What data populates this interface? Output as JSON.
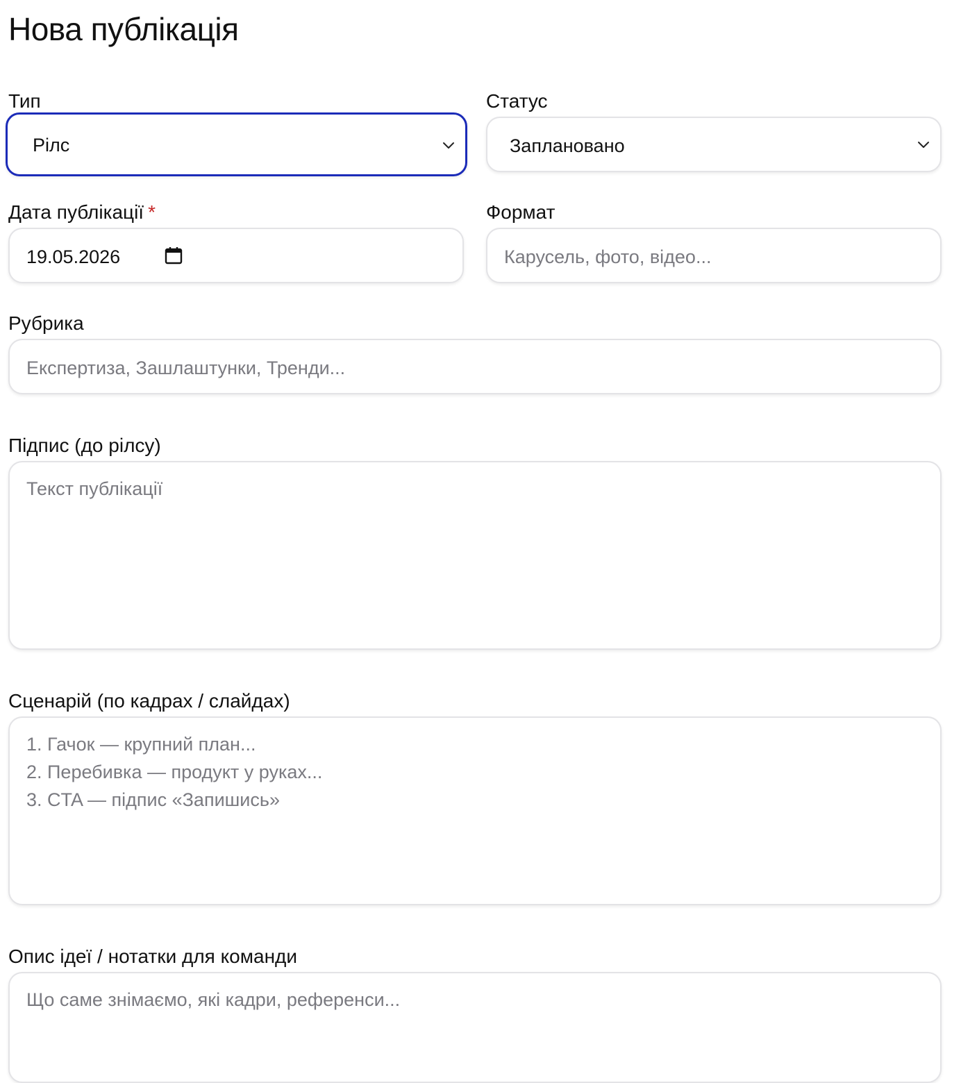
{
  "page": {
    "title": "Нова публікація"
  },
  "form": {
    "type": {
      "label": "Тип",
      "value": "Рілс"
    },
    "status": {
      "label": "Статус",
      "value": "Заплановано"
    },
    "date": {
      "label": "Дата публікації",
      "required_mark": "*",
      "value": "19.05.2026"
    },
    "format": {
      "label": "Формат",
      "placeholder": "Карусель, фото, відео..."
    },
    "rubric": {
      "label": "Рубрика",
      "placeholder": "Експертиза, Зашлаштунки, Тренди..."
    },
    "caption": {
      "label": "Підпис (до рілсу)",
      "placeholder": "Текст публікації"
    },
    "script": {
      "label": "Сценарій (по кадрах / слайдах)",
      "placeholder": "1. Гачок — крупний план...\n2. Перебивка — продукт у руках...\n3. CTA — підпис «Запишись»"
    },
    "notes": {
      "label": "Опис ідеї / нотатки для команди",
      "placeholder": "Що саме знімаємо, які кадри, референси..."
    }
  },
  "colors": {
    "focus_border": "#1b2bb8",
    "required": "#c62828",
    "placeholder": "#7a7a80",
    "field_border": "#e3e3e6"
  },
  "icons": {
    "select": "chevron-down-icon",
    "date": "calendar-icon"
  }
}
